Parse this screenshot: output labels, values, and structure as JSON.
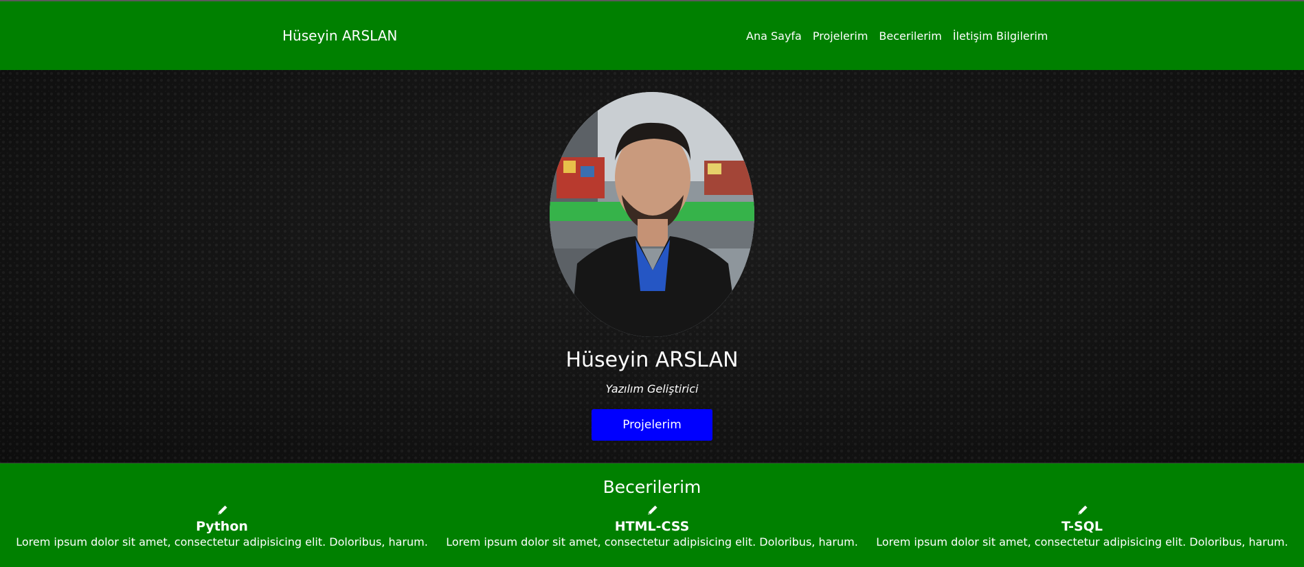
{
  "brand": "Hüseyin ARSLAN",
  "nav": [
    "Ana Sayfa",
    "Projelerim",
    "Becerilerim",
    "İletişim Bilgilerim"
  ],
  "hero": {
    "name": "Hüseyin ARSLAN",
    "role": "Yazılım Geliştirici",
    "button": "Projelerim"
  },
  "skills": {
    "title": "Becerilerim",
    "items": [
      {
        "title": "Python",
        "desc": "Lorem ipsum dolor sit amet, consectetur adipisicing elit. Doloribus, harum.",
        "icon": "pencil-icon"
      },
      {
        "title": "HTML-CSS",
        "desc": "Lorem ipsum dolor sit amet, consectetur adipisicing elit. Doloribus, harum.",
        "icon": "pencil-icon"
      },
      {
        "title": "T-SQL",
        "desc": "Lorem ipsum dolor sit amet, consectetur adipisicing elit. Doloribus, harum.",
        "icon": "pencil-icon"
      }
    ]
  },
  "colors": {
    "navbar": "#008000",
    "hero_bg": "#141414",
    "button": "#0000ff"
  }
}
